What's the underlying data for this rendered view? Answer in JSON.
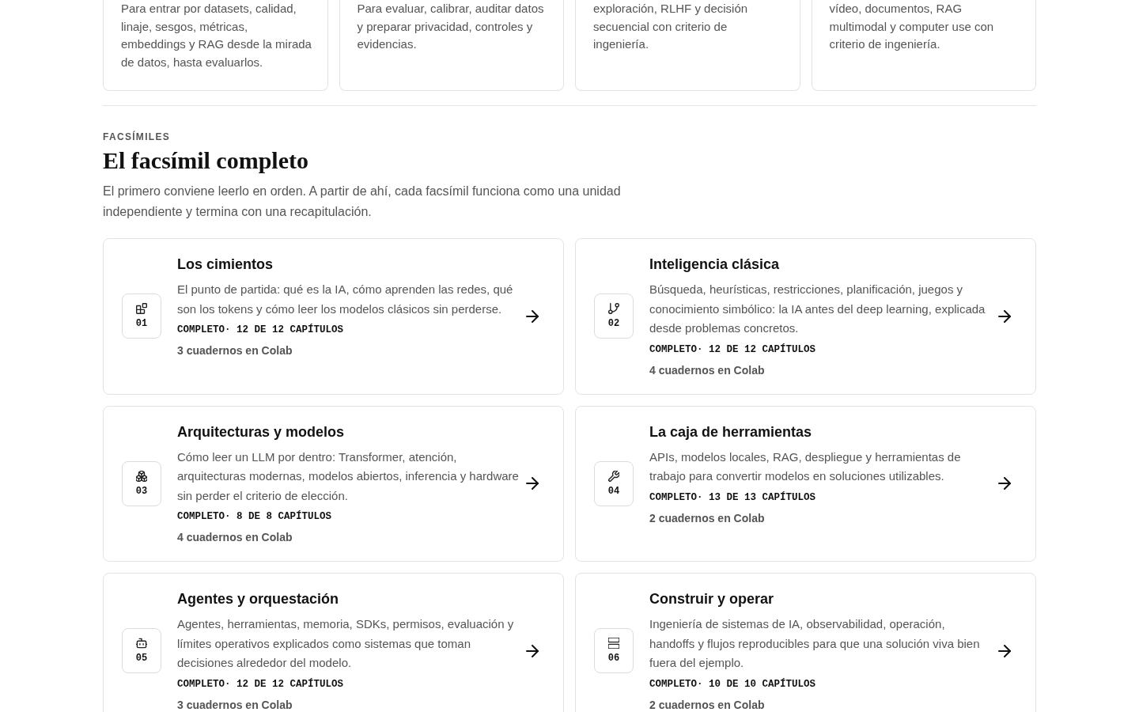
{
  "intro_cards": [
    {
      "description": "Para entrar por datasets, calidad, linaje, sesgos, métricas, embeddings y RAG desde la mirada de datos, hasta evaluarlos."
    },
    {
      "description": "Para evaluar, calibrar, auditar datos y preparar privacidad, controles y evidencias."
    },
    {
      "description": "exploración, RLHF y decisión secuencial con criterio de ingeniería."
    },
    {
      "description": "vídeo, documentos, RAG multimodal y computer use con criterio de ingeniería."
    }
  ],
  "section": {
    "eyebrow": "FACSÍMILES",
    "title": "El facsímil completo",
    "description": "El primero conviene leerlo en orden. A partir de ahí, cada facsímil funciona como una unidad independiente y termina con una recapitulación."
  },
  "modules": [
    {
      "number": "01",
      "title": "Los cimientos",
      "description": "El punto de partida: qué es la IA, cómo aprenden las redes, qué son los tokens y cómo leer los modelos clásicos sin perderse.",
      "status": "COMPLETO· 12 DE 12 CAPÍTULOS",
      "notebooks": "3 cuadernos en Colab"
    },
    {
      "number": "02",
      "title": "Inteligencia clásica",
      "description": "Búsqueda, heurísticas, restricciones, planificación, juegos y conocimiento simbólico: la IA antes del deep learning, explicada desde problemas concretos.",
      "status": "COMPLETO· 12 DE 12 CAPÍTULOS",
      "notebooks": "4 cuadernos en Colab"
    },
    {
      "number": "03",
      "title": "Arquitecturas y modelos",
      "description": "Cómo leer un LLM por dentro: Transformer, atención, arquitecturas modernas, modelos abiertos, inferencia y hardware sin perder el criterio de elección.",
      "status": "COMPLETO· 8 DE 8 CAPÍTULOS",
      "notebooks": "4 cuadernos en Colab"
    },
    {
      "number": "04",
      "title": "La caja de herramientas",
      "description": "APIs, modelos locales, RAG, despliegue y herramientas de trabajo para convertir modelos en soluciones utilizables.",
      "status": "COMPLETO· 13 DE 13 CAPÍTULOS",
      "notebooks": "2 cuadernos en Colab"
    },
    {
      "number": "05",
      "title": "Agentes y orquestación",
      "description": "Agentes, herramientas, memoria, SDKs, permisos, evaluación y límites operativos explicados como sistemas que toman decisiones alrededor del modelo.",
      "status": "COMPLETO· 12 DE 12 CAPÍTULOS",
      "notebooks": "3 cuadernos en Colab"
    },
    {
      "number": "06",
      "title": "Construir y operar",
      "description": "Ingeniería de sistemas de IA, observabilidad, operación, handoffs y flujos reproducibles para que una solución viva bien fuera del ejemplo.",
      "status": "COMPLETO· 10 DE 10 CAPÍTULOS",
      "notebooks": "2 cuadernos en Colab"
    }
  ]
}
